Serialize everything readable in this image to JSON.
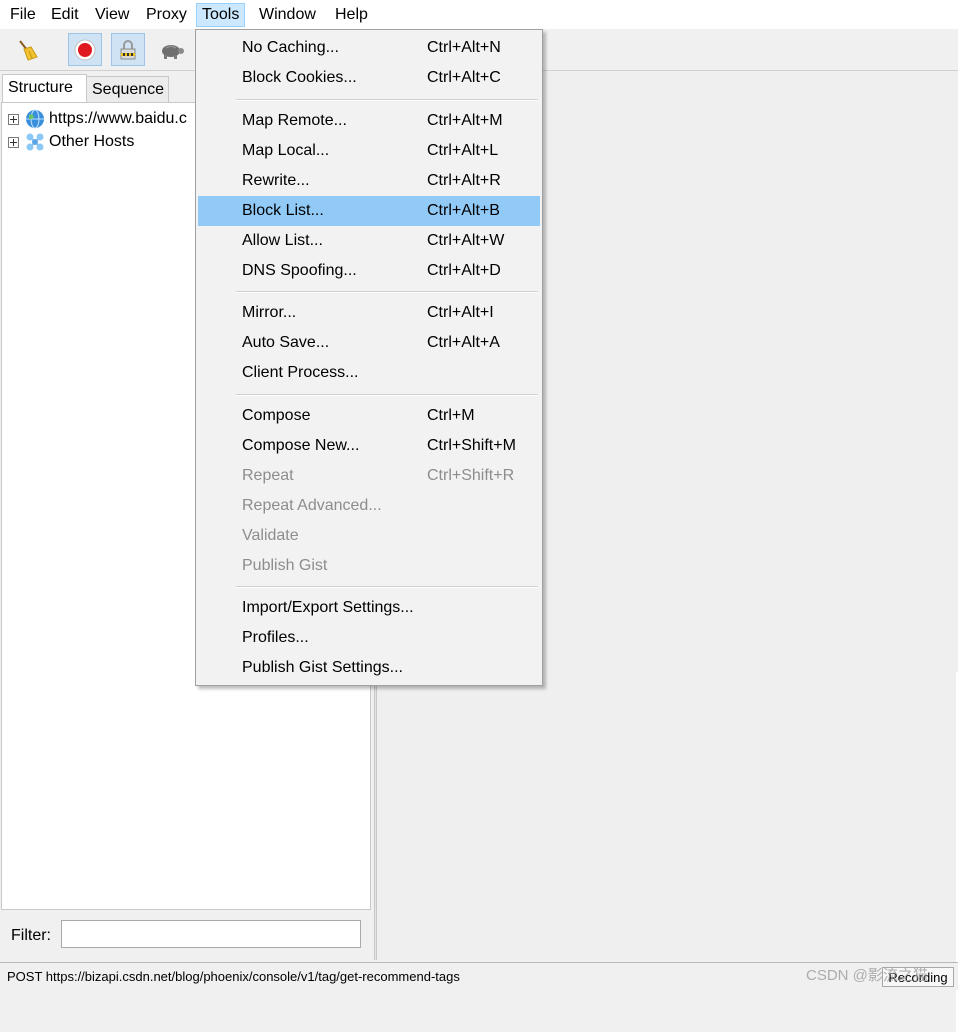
{
  "menubar": {
    "items": [
      "File",
      "Edit",
      "View",
      "Proxy",
      "Tools",
      "Window",
      "Help"
    ],
    "active": "Tools"
  },
  "toolbar": {
    "buttons": [
      {
        "icon": "broom-icon",
        "pressed": false
      },
      {
        "icon": "record-icon",
        "pressed": true
      },
      {
        "icon": "ssl-lock-icon",
        "pressed": true
      },
      {
        "icon": "turtle-throttle-icon",
        "pressed": false
      }
    ]
  },
  "left": {
    "tabs": [
      "Structure",
      "Sequence"
    ],
    "selected_tab": "Structure",
    "tree": [
      {
        "label": "https://www.baidu.c",
        "icon": "globe-icon"
      },
      {
        "label": "Other Hosts",
        "icon": "network-hosts-icon"
      }
    ],
    "filter": {
      "label": "Filter:",
      "value": ""
    }
  },
  "tools_menu": {
    "groups": [
      [
        {
          "label": "No Caching...",
          "shortcut": "Ctrl+Alt+N",
          "enabled": true
        },
        {
          "label": "Block Cookies...",
          "shortcut": "Ctrl+Alt+C",
          "enabled": true
        }
      ],
      [
        {
          "label": "Map Remote...",
          "shortcut": "Ctrl+Alt+M",
          "enabled": true
        },
        {
          "label": "Map Local...",
          "shortcut": "Ctrl+Alt+L",
          "enabled": true
        },
        {
          "label": "Rewrite...",
          "shortcut": "Ctrl+Alt+R",
          "enabled": true
        },
        {
          "label": "Block List...",
          "shortcut": "Ctrl+Alt+B",
          "enabled": true,
          "highlighted": true
        },
        {
          "label": "Allow List...",
          "shortcut": "Ctrl+Alt+W",
          "enabled": true
        },
        {
          "label": "DNS Spoofing...",
          "shortcut": "Ctrl+Alt+D",
          "enabled": true
        }
      ],
      [
        {
          "label": "Mirror...",
          "shortcut": "Ctrl+Alt+I",
          "enabled": true
        },
        {
          "label": "Auto Save...",
          "shortcut": "Ctrl+Alt+A",
          "enabled": true
        },
        {
          "label": "Client Process...",
          "shortcut": "",
          "enabled": true
        }
      ],
      [
        {
          "label": "Compose",
          "shortcut": "Ctrl+M",
          "enabled": true
        },
        {
          "label": "Compose New...",
          "shortcut": "Ctrl+Shift+M",
          "enabled": true
        },
        {
          "label": "Repeat",
          "shortcut": "Ctrl+Shift+R",
          "enabled": false
        },
        {
          "label": "Repeat Advanced...",
          "shortcut": "",
          "enabled": false
        },
        {
          "label": "Validate",
          "shortcut": "",
          "enabled": false
        },
        {
          "label": "Publish Gist",
          "shortcut": "",
          "enabled": false
        }
      ],
      [
        {
          "label": "Import/Export Settings...",
          "shortcut": "",
          "enabled": true
        },
        {
          "label": "Profiles...",
          "shortcut": "",
          "enabled": true
        },
        {
          "label": "Publish Gist Settings...",
          "shortcut": "",
          "enabled": true
        }
      ]
    ]
  },
  "status": {
    "text": "POST https://bizapi.csdn.net/blog/phoenix/console/v1/tag/get-recommend-tags",
    "recording": "Recording"
  },
  "watermark": "CSDN @影流之猫",
  "colors": {
    "highlight": "#91c9f7",
    "menu_active": "#cce8ff",
    "disabled_text": "#8d8d8d"
  }
}
